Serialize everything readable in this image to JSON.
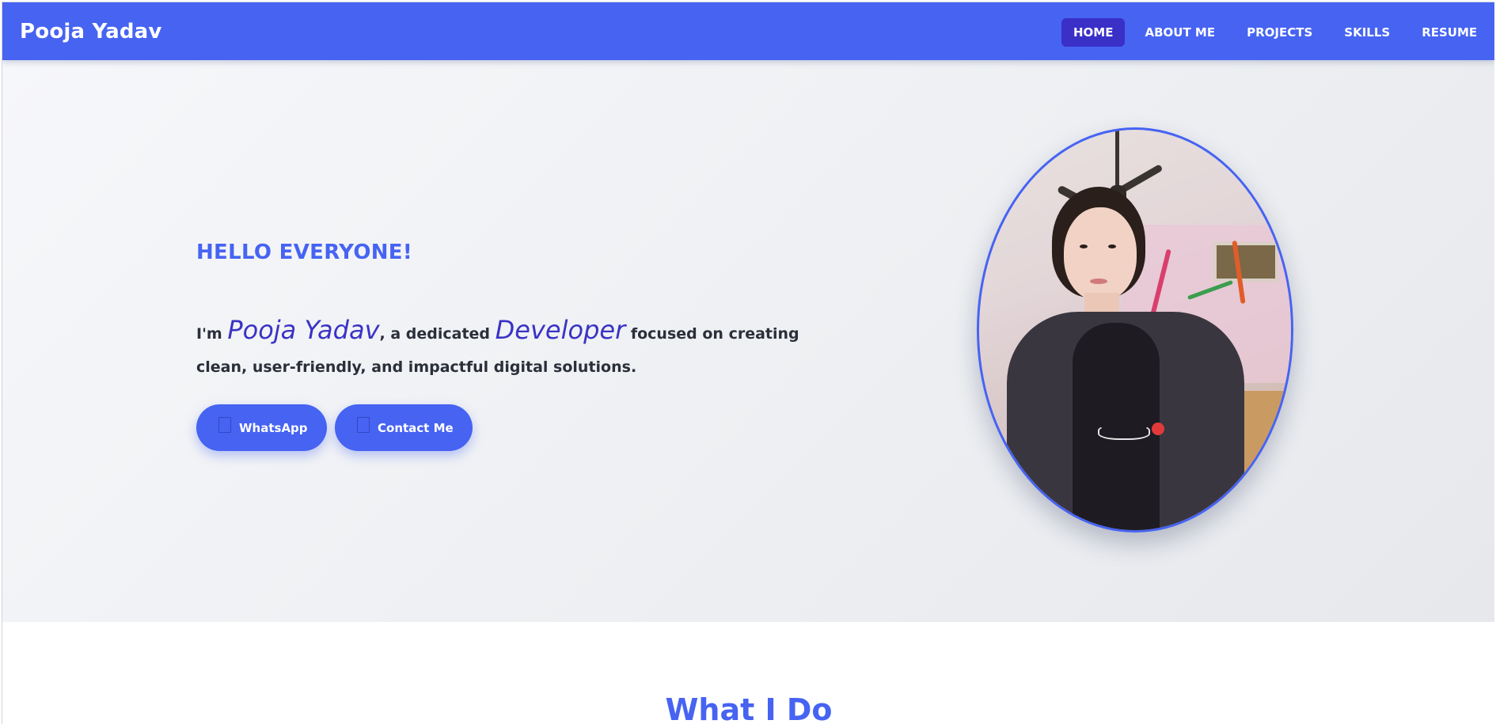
{
  "navbar": {
    "brand": "Pooja Yadav",
    "links": [
      {
        "label": "HOME",
        "active": true
      },
      {
        "label": "ABOUT ME",
        "active": false
      },
      {
        "label": "PROJECTS",
        "active": false
      },
      {
        "label": "SKILLS",
        "active": false
      },
      {
        "label": "RESUME",
        "active": false
      }
    ]
  },
  "hero": {
    "greeting": "HELLO EVERYONE!",
    "intro_prefix": "I'm ",
    "intro_name": "Pooja Yadav",
    "intro_mid": ", a dedicated ",
    "intro_role": "Developer",
    "intro_suffix": " focused on creating clean, user-friendly, and impactful digital solutions.",
    "buttons": {
      "whatsapp": {
        "label": "WhatsApp",
        "icon": "whatsapp-icon"
      },
      "contact": {
        "label": "Contact Me",
        "icon": "envelope-icon"
      }
    }
  },
  "section": {
    "title": "What I Do"
  },
  "colors": {
    "primary": "#4663f2",
    "active_nav": "#3a2fc7",
    "highlight_text": "#3a33c4",
    "body_text": "#2b2f3a"
  }
}
